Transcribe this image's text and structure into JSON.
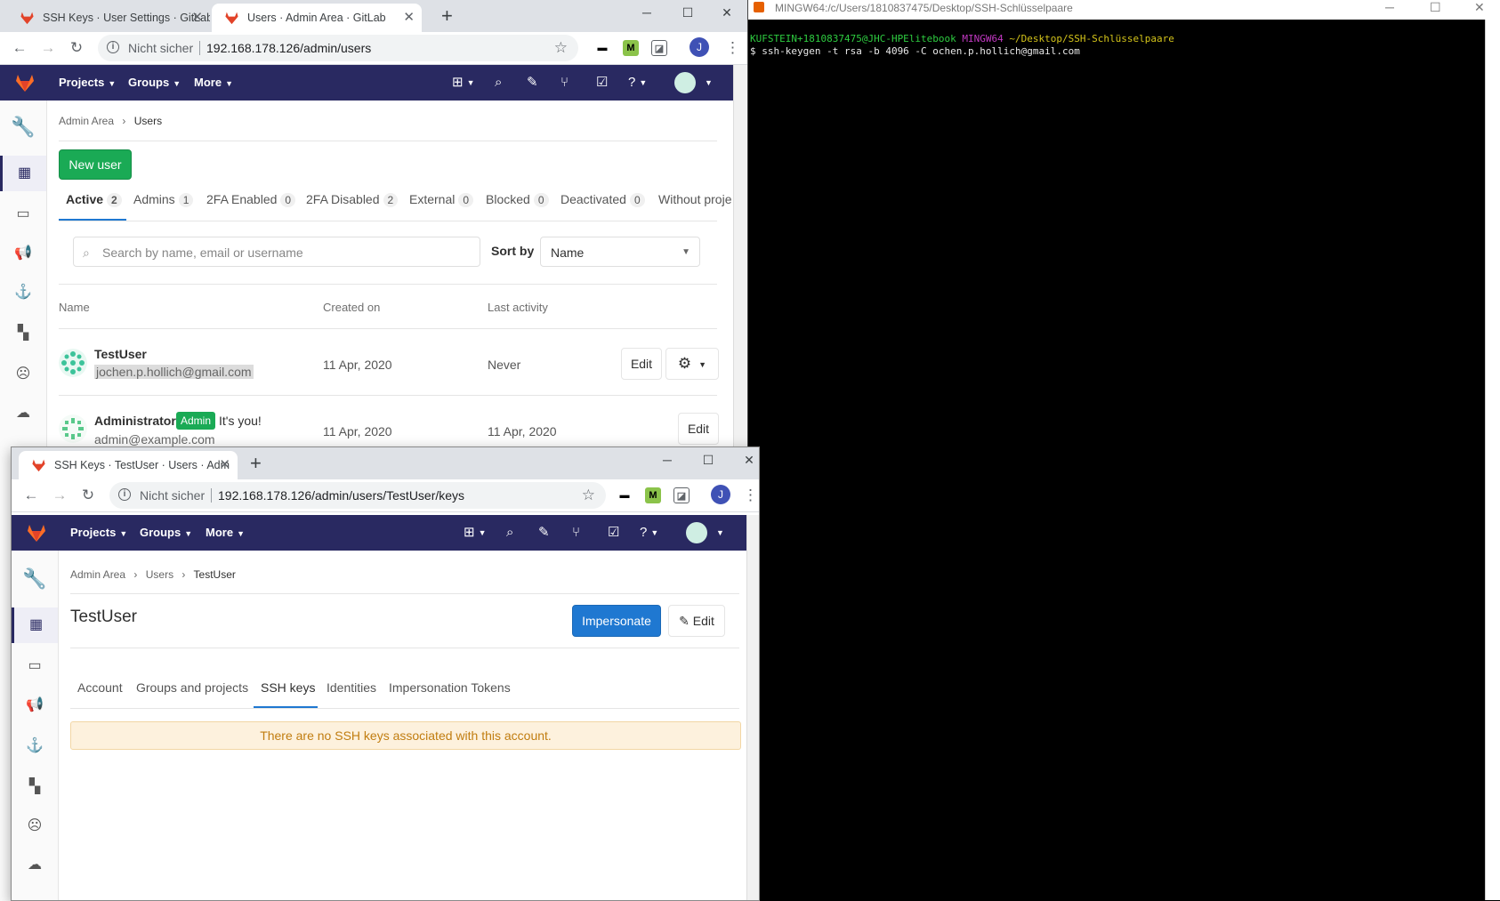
{
  "browser1": {
    "tabs": [
      {
        "title": "SSH Keys · User Settings · GitLab"
      },
      {
        "title": "Users · Admin Area · GitLab"
      }
    ],
    "insecure_label": "Nicht sicher",
    "url": "192.168.178.126/admin/users",
    "profile_initial": "J"
  },
  "browser2": {
    "tabs": [
      {
        "title": "SSH Keys · TestUser · Users · Adm"
      }
    ],
    "insecure_label": "Nicht sicher",
    "url": "192.168.178.126/admin/users/TestUser/keys",
    "profile_initial": "J"
  },
  "gitlab_nav": {
    "projects": "Projects",
    "groups": "Groups",
    "more": "More"
  },
  "users_page": {
    "breadcrumb": {
      "root": "Admin Area",
      "current": "Users"
    },
    "new_user_button": "New user",
    "tabs": [
      {
        "label": "Active",
        "count": "2"
      },
      {
        "label": "Admins",
        "count": "1"
      },
      {
        "label": "2FA Enabled",
        "count": "0"
      },
      {
        "label": "2FA Disabled",
        "count": "2"
      },
      {
        "label": "External",
        "count": "0"
      },
      {
        "label": "Blocked",
        "count": "0"
      },
      {
        "label": "Deactivated",
        "count": "0"
      },
      {
        "label": "Without proje"
      }
    ],
    "search_placeholder": "Search by name, email or username",
    "sort_label": "Sort by",
    "sort_value": "Name",
    "columns": {
      "name": "Name",
      "created": "Created on",
      "activity": "Last activity"
    },
    "rows": [
      {
        "name": "TestUser",
        "email": "jochen.p.hollich@gmail.com",
        "created": "11 Apr, 2020",
        "activity": "Never",
        "edit": "Edit"
      },
      {
        "name": "Administrator",
        "badge": "Admin",
        "note": "It's you!",
        "email": "admin@example.com",
        "created": "11 Apr, 2020",
        "activity": "11 Apr, 2020",
        "edit": "Edit"
      }
    ]
  },
  "keys_page": {
    "breadcrumb": {
      "root": "Admin Area",
      "mid": "Users",
      "current": "TestUser"
    },
    "title": "TestUser",
    "impersonate_button": "Impersonate",
    "edit_button": "Edit",
    "tabs": [
      "Account",
      "Groups and projects",
      "SSH keys",
      "Identities",
      "Impersonation Tokens"
    ],
    "empty_message": "There are no SSH keys associated with this account."
  },
  "terminal": {
    "title": "MINGW64:/c/Users/1810837475/Desktop/SSH-Schlüsselpaare",
    "prompt_user": "KUFSTEIN+1810837475@JHC-HPElitebook",
    "prompt_env": "MINGW64",
    "prompt_path": "~/Desktop/SSH-Schlüsselpaare",
    "command": "$ ssh-keygen -t rsa -b 4096 -C ochen.p.hollich@gmail.com"
  },
  "colors": {
    "gitlab_header": "#292961",
    "primary_green": "#1aaa55",
    "primary_blue": "#1f78d1",
    "terminal_green": "#2ecc40",
    "terminal_magenta": "#c238c2",
    "terminal_yellow": "#d4c41a"
  }
}
